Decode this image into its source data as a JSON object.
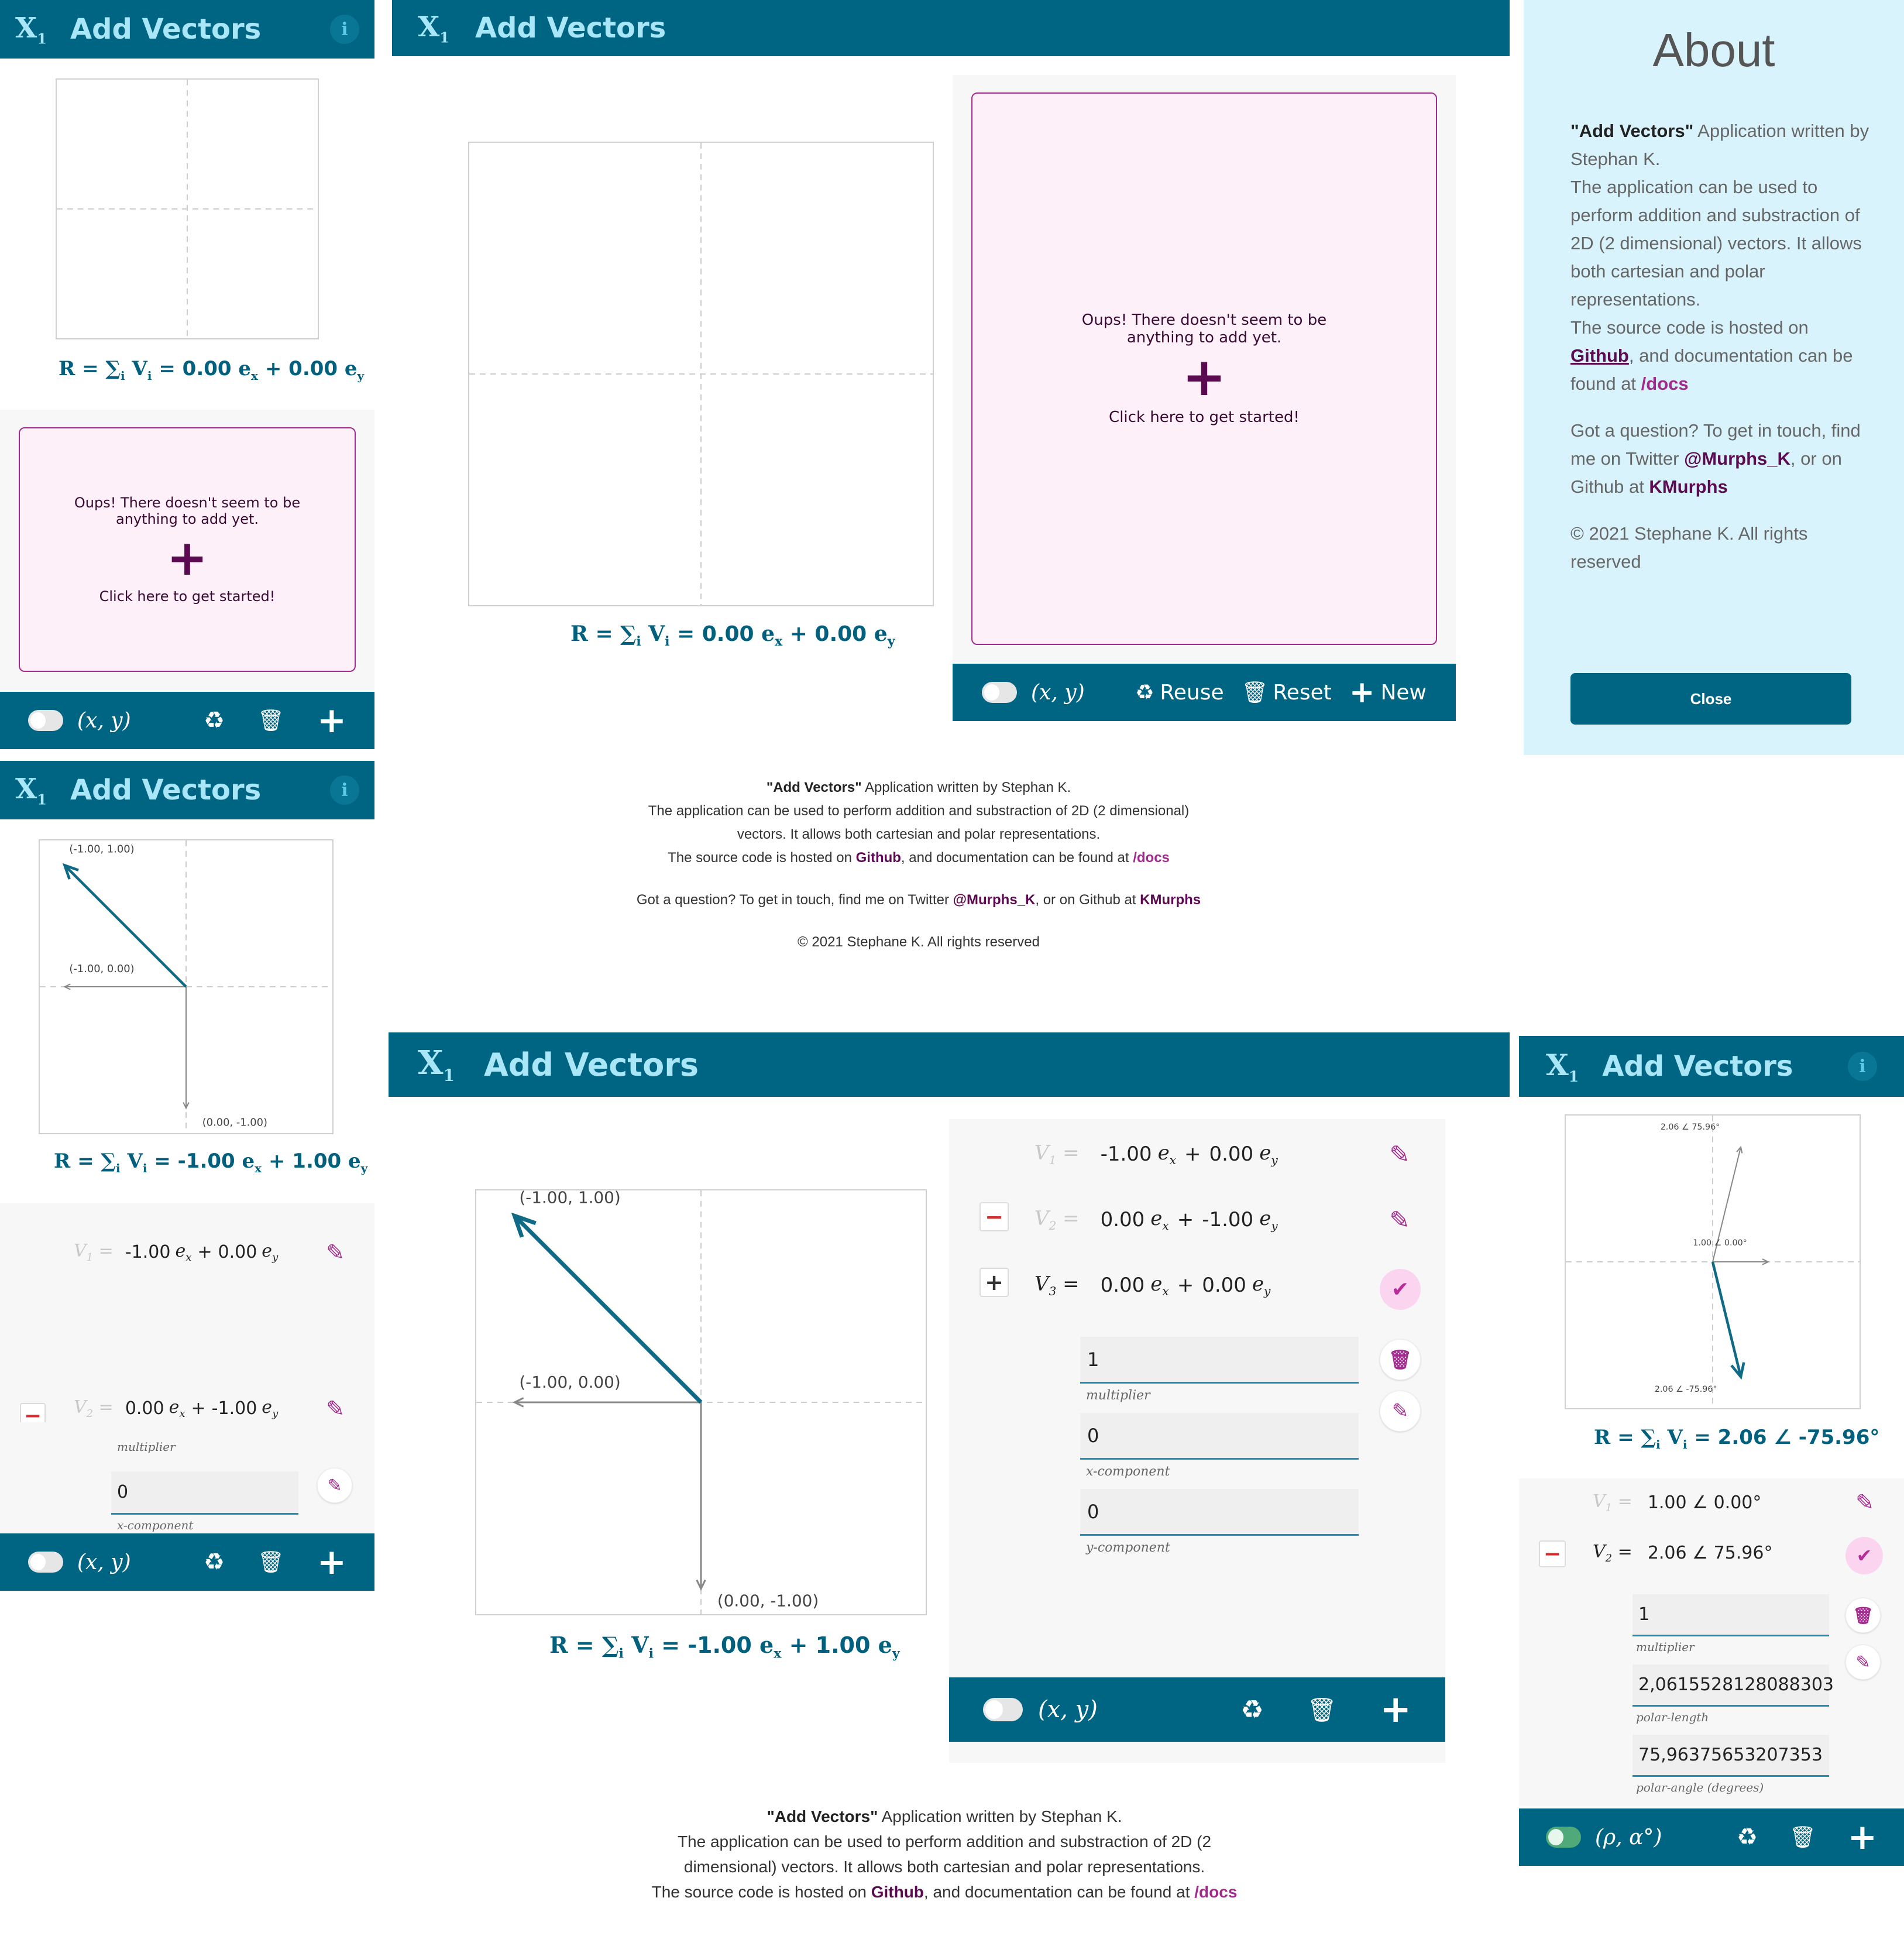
{
  "app": {
    "icon_main": "X",
    "icon_sub": "1",
    "title": "Add Vectors",
    "info_icon": "i"
  },
  "empty_state": {
    "message": "Oups! There doesn't seem to be anything to add yet.",
    "plus": "+",
    "cta": "Click here to get started!"
  },
  "toolbar": {
    "mode_cartesian": "(x, y)",
    "mode_polar": "(ρ, α°)",
    "reuse_label": "Reuse",
    "reset_label": "Reset",
    "new_label": "New",
    "recycle_icon": "♻",
    "trash_icon": "🗑",
    "plus_icon": "+"
  },
  "result": {
    "prefix": "R = ∑",
    "sub_i": "i",
    "vi": "V",
    "eq": "=",
    "zero_x": "0.00",
    "zero_y": "0.00",
    "neg_x": "-1.00",
    "pos_y": "1.00",
    "polar": "2.06 ∠ -75.96°",
    "ex": "e",
    "ex_sub": "x",
    "ey_sub": "y",
    "plus": "+"
  },
  "chart_labels": {
    "a": "(-1.00, 1.00)",
    "b": "(-1.00, 0.00)",
    "c": "(0.00, -1.00)",
    "pa": "2.06 ∠ 75.96°",
    "pb": "1.00 ∠ 0.00°",
    "pc": "2.06 ∠ -75.96°"
  },
  "vectors_cart": [
    {
      "label": "V",
      "sub": "1",
      "x": "-1.00",
      "y": "0.00"
    },
    {
      "label": "V",
      "sub": "2",
      "x": "0.00",
      "y": "-1.00"
    },
    {
      "label": "V",
      "sub": "3",
      "x": "0.00",
      "y": "0.00"
    }
  ],
  "vectors_polar": [
    {
      "label": "V",
      "sub": "1",
      "value": "1.00 ∠ 0.00°"
    },
    {
      "label": "V",
      "sub": "2",
      "value": "2.06 ∠ 75.96°"
    }
  ],
  "fields_cart": {
    "multiplier": "1",
    "multiplier_label": "multiplier",
    "x": "0",
    "x_label": "x-component",
    "y": "0",
    "y_label": "y-component"
  },
  "fields_polar": {
    "multiplier": "1",
    "multiplier_label": "multiplier",
    "length": "2,0615528128088303",
    "length_label": "polar-length",
    "angle": "75,96375653207353",
    "angle_label": "polar-angle (degrees)"
  },
  "icons": {
    "pencil": "✎",
    "check": "✔",
    "minus": "−",
    "plus": "+"
  },
  "about": {
    "heading": "About",
    "app_quoted": "\"Add Vectors\"",
    "line1": " Application written by Stephan K.",
    "line2": "The application can be used to perform addition and substraction of 2D (2 dimensional) vectors. It allows both cartesian and polar representations.",
    "line3a": "The source code is hosted on ",
    "github": "Github",
    "line3b": ", and documentation can be found at ",
    "docs": "/docs",
    "q1": "Got a question? To get in touch, find me on Twitter ",
    "twitter": "@Murphs_K",
    "q2": ", or on Github at ",
    "kmurphs": "KMurphs",
    "copyright": "© 2021 Stephane K. All rights reserved",
    "close": "Close"
  },
  "colors": {
    "header": "#006582",
    "header_text": "#a9e6f7",
    "accent": "#a12a8c",
    "vector": "#0e6a85",
    "about_bg": "#d8f3fc"
  }
}
